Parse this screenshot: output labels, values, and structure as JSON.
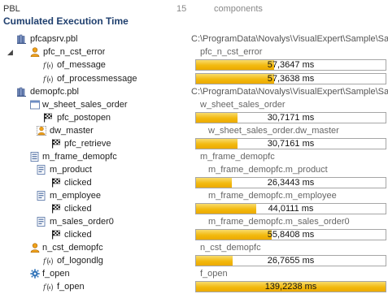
{
  "header": {
    "pbl_label": "PBL",
    "count": "15",
    "components_label": "components"
  },
  "title": "Cumulated Execution Time",
  "rows": [
    {
      "name": "pfcapsrv.pbl",
      "col2": "C:\\ProgramData\\Novalys\\VisualExpert\\Sample\\Sa",
      "icon": "library-icon"
    },
    {
      "name": "pfc_n_cst_error",
      "col2": "pfc_n_cst_error",
      "icon": "user-object-icon",
      "expander": "◢"
    },
    {
      "name": "of_message",
      "bar_text": "57,3647 ms",
      "fill": 0.412,
      "icon": "function-icon"
    },
    {
      "name": "of_processmessage",
      "bar_text": "57,3638 ms",
      "fill": 0.412,
      "icon": "function-icon"
    },
    {
      "name": "demopfc.pbl",
      "col2": "C:\\ProgramData\\Novalys\\VisualExpert\\Sample\\Sa",
      "icon": "library-icon"
    },
    {
      "name": "w_sheet_sales_order",
      "col2": "w_sheet_sales_order",
      "icon": "window-icon"
    },
    {
      "name": "pfc_postopen",
      "bar_text": "30,7171 ms",
      "fill": 0.221,
      "icon": "event-icon"
    },
    {
      "name": "dw_master",
      "col2": "w_sheet_sales_order.dw_master",
      "icon": "datawindow-control-icon"
    },
    {
      "name": "pfc_retrieve",
      "bar_text": "30,7161 ms",
      "fill": 0.221,
      "icon": "event-icon"
    },
    {
      "name": "m_frame_demopfc",
      "col2": "m_frame_demopfc",
      "icon": "menu-icon"
    },
    {
      "name": "m_product",
      "col2": "m_frame_demopfc.m_product",
      "icon": "menu-item-icon"
    },
    {
      "name": "clicked",
      "bar_text": "26,3443 ms",
      "fill": 0.189,
      "icon": "event-icon"
    },
    {
      "name": "m_employee",
      "col2": "m_frame_demopfc.m_employee",
      "icon": "menu-item-icon"
    },
    {
      "name": "clicked",
      "bar_text": "44,0111 ms",
      "fill": 0.316,
      "icon": "event-icon"
    },
    {
      "name": "m_sales_order0",
      "col2": "m_frame_demopfc.m_sales_order0",
      "icon": "menu-item-icon"
    },
    {
      "name": "clicked",
      "bar_text": "55,8408 ms",
      "fill": 0.401,
      "icon": "event-icon"
    },
    {
      "name": "n_cst_demopfc",
      "col2": "n_cst_demopfc",
      "icon": "user-object-icon"
    },
    {
      "name": "of_logondlg",
      "bar_text": "26,7655 ms",
      "fill": 0.192,
      "icon": "function-icon"
    },
    {
      "name": "f_open",
      "col2": "f_open",
      "icon": "global-function-icon"
    },
    {
      "name": "f_open",
      "bar_text": "139,2238 ms",
      "fill": 1.0,
      "icon": "function-icon"
    }
  ],
  "colors": {
    "bar_fill": "#f2b90f",
    "title": "#1f3f6e",
    "bar_border": "#a6a6a6"
  }
}
